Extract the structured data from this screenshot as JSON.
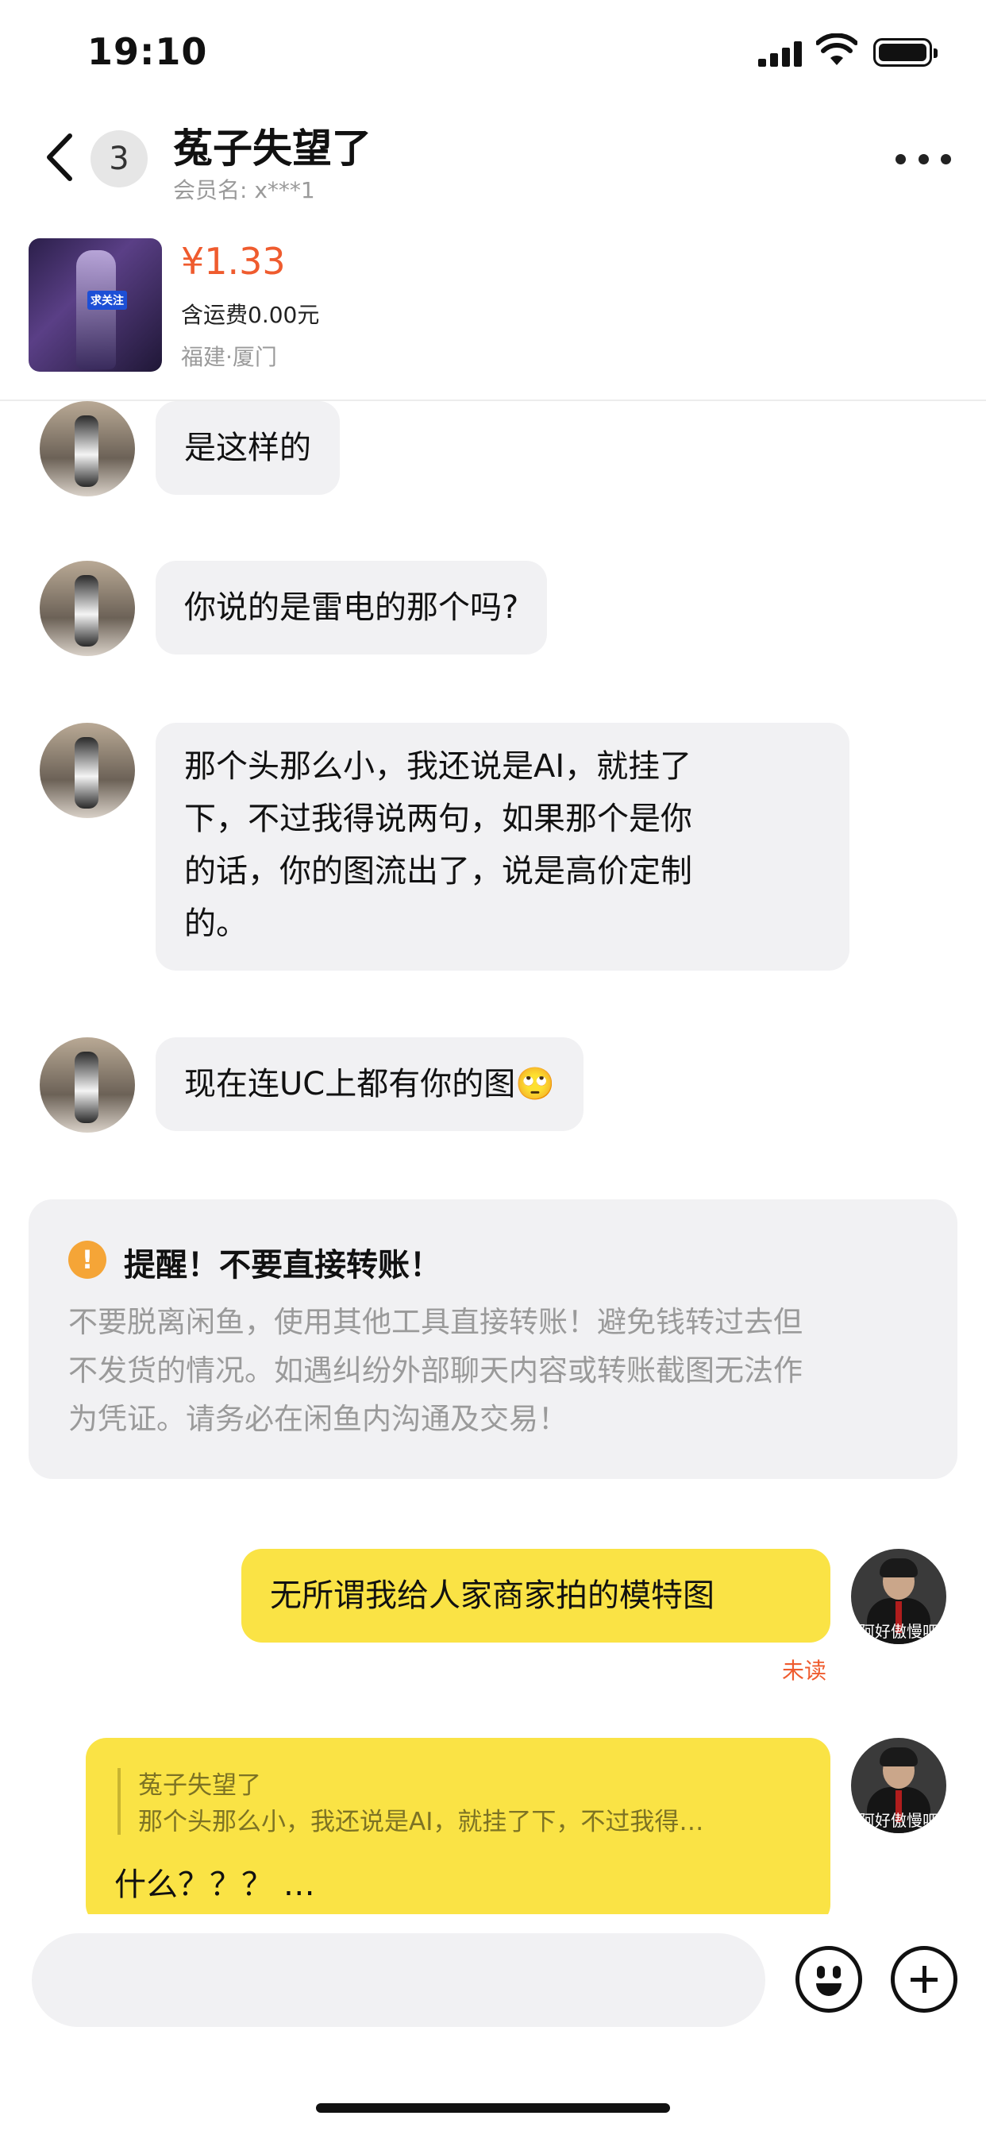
{
  "status_bar": {
    "time": "19:10"
  },
  "header": {
    "unread_count": "3",
    "title": "菟子失望了",
    "member_label": "会员名: x***1"
  },
  "product": {
    "thumbnail_tag": "求关注",
    "price": "¥1.33",
    "shipping": "含运费0.00元",
    "location": "福建·厦门"
  },
  "messages": [
    {
      "from": "peer",
      "text": "是这样的"
    },
    {
      "from": "peer",
      "text": "你说的是雷电的那个吗?"
    },
    {
      "from": "peer",
      "lines": [
        "那个头那么小，我还说是AI，就挂了",
        "下，不过我得说两句，如果那个是你",
        "的话，你的图流出了，说是高价定制",
        "的。"
      ]
    },
    {
      "from": "peer",
      "text": "现在连UC上都有你的图",
      "emoji": "🙄"
    },
    {
      "from": "self",
      "text": "无所谓我给人家商家拍的模特图",
      "status": "未读"
    },
    {
      "from": "self",
      "quote_name": "菟子失望了",
      "quote_text": "那个头那么小，我还说是AI，就挂了下，不过我得…",
      "text": "什么？？？ …"
    }
  ],
  "notice": {
    "icon": "!",
    "title": "提醒！不要直接转账！",
    "lines": [
      "不要脱离闲鱼，使用其他工具直接转账！避免钱转过去但",
      "不发货的情况。如遇纠纷外部聊天内容或转账截图无法作",
      "为凭证。请务必在闲鱼内沟通及交易！"
    ]
  },
  "self_avatar_caption": "阿好傲慢吧",
  "input": {
    "placeholder": ""
  },
  "colors": {
    "accent": "#ef5b2e",
    "self_bubble": "#fae345",
    "peer_bubble": "#f1f1f3",
    "warning": "#f5a537"
  }
}
